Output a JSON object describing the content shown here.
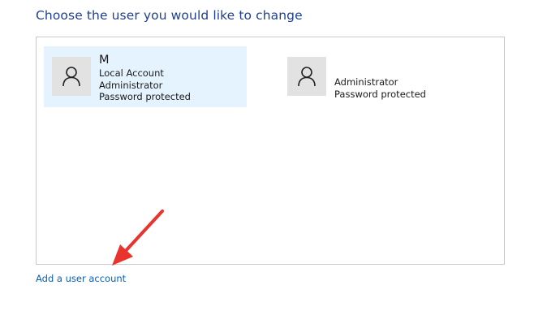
{
  "heading": "Choose the user you would like to change",
  "accounts": [
    {
      "name": "M",
      "details": [
        "Local Account",
        "Administrator",
        "Password protected"
      ],
      "selected": true,
      "avatar_icon": "user-silhouette-icon"
    },
    {
      "name": "",
      "details": [
        "Administrator",
        "Password protected"
      ],
      "selected": false,
      "avatar_icon": "user-silhouette-icon"
    }
  ],
  "add_account_link": "Add a user account",
  "colors": {
    "heading": "#1e3f92",
    "selected_tile_bg": "#e5f3ff",
    "link": "#0a5fb6",
    "annotation_arrow": "#e8332f"
  }
}
